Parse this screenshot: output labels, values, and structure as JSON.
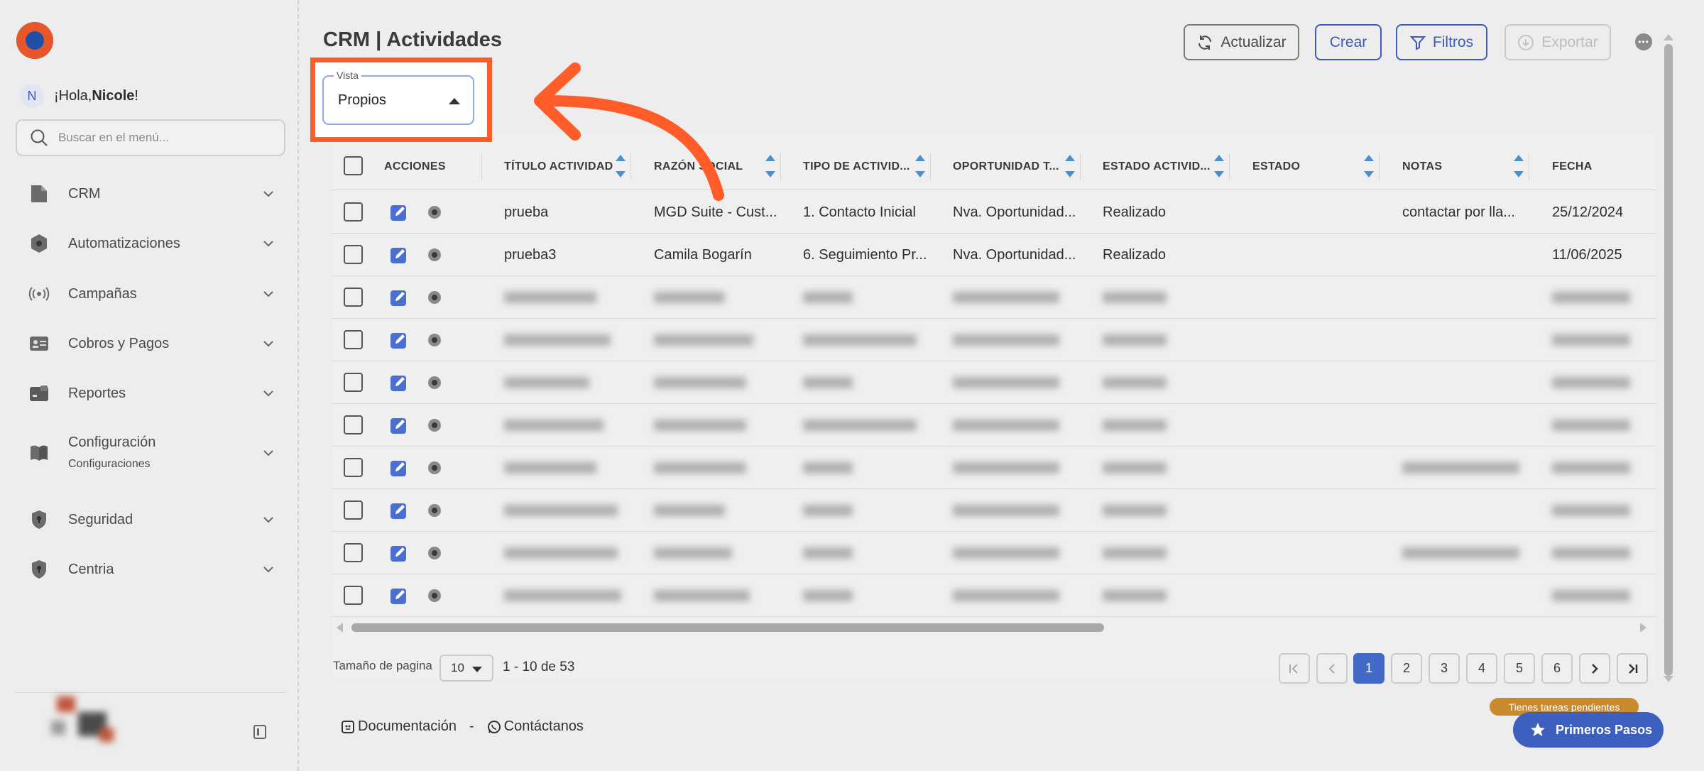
{
  "sidebar": {
    "greeting_prefix": "¡Hola, ",
    "user_name": "Nicole",
    "greeting_suffix": "!",
    "avatar_initial": "N",
    "search_placeholder": "Buscar en el menú...",
    "items": [
      {
        "label": "CRM",
        "icon": "document-icon"
      },
      {
        "label": "Automatizaciones",
        "icon": "gear-hex-icon"
      },
      {
        "label": "Campañas",
        "icon": "broadcast-icon"
      },
      {
        "label": "Cobros y Pagos",
        "icon": "id-card-icon"
      },
      {
        "label": "Reportes",
        "icon": "wallet-icon"
      },
      {
        "label": "Configuración",
        "sub": "Configuraciones",
        "icon": "book-icon"
      },
      {
        "label": "Seguridad",
        "icon": "shield-icon"
      },
      {
        "label": "Centria",
        "icon": "shield-icon"
      }
    ]
  },
  "header": {
    "title": "CRM | Actividades",
    "buttons": {
      "update": "Actualizar",
      "create": "Crear",
      "filters": "Filtros",
      "export": "Exportar"
    }
  },
  "view_select": {
    "legend": "Vista",
    "value": "Propios"
  },
  "table": {
    "columns": [
      "ACCIONES",
      "TÍTULO ACTIVIDAD",
      "RAZÓN SOCIAL",
      "TIPO DE ACTIVID...",
      "OPORTUNIDAD T...",
      "ESTADO ACTIVID...",
      "ESTADO",
      "NOTAS",
      "FECHA"
    ],
    "rows": [
      {
        "titulo": "prueba",
        "razon": "MGD Suite - Cust...",
        "tipo": "1. Contacto Inicial",
        "oportunidad": "Nva. Oportunidad...",
        "estado_act": "Realizado",
        "estado": "",
        "notas": "contactar por lla...",
        "fecha": "25/12/2024"
      },
      {
        "titulo": "prueba3",
        "razon": "Camila Bogarín",
        "tipo": "6. Seguimiento Pr...",
        "oportunidad": "Nva. Oportunidad...",
        "estado_act": "Realizado",
        "estado": "",
        "notas": "",
        "fecha": "11/06/2025"
      }
    ]
  },
  "pagination": {
    "size_label": "Tamaño de pagina",
    "size_value": "10",
    "range": "1 - 10 de 53",
    "pages": [
      "1",
      "2",
      "3",
      "4",
      "5",
      "6"
    ],
    "active_page": "1"
  },
  "footer": {
    "docs": "Documentación",
    "separator": "-",
    "contact": "Contáctanos"
  },
  "onboarding": {
    "badge": "Tienes tareas pendientes",
    "button": "Primeros Pasos"
  },
  "colors": {
    "accent": "#3d5bb8",
    "highlight": "#ff5c2a",
    "pending": "#c98a2d"
  }
}
